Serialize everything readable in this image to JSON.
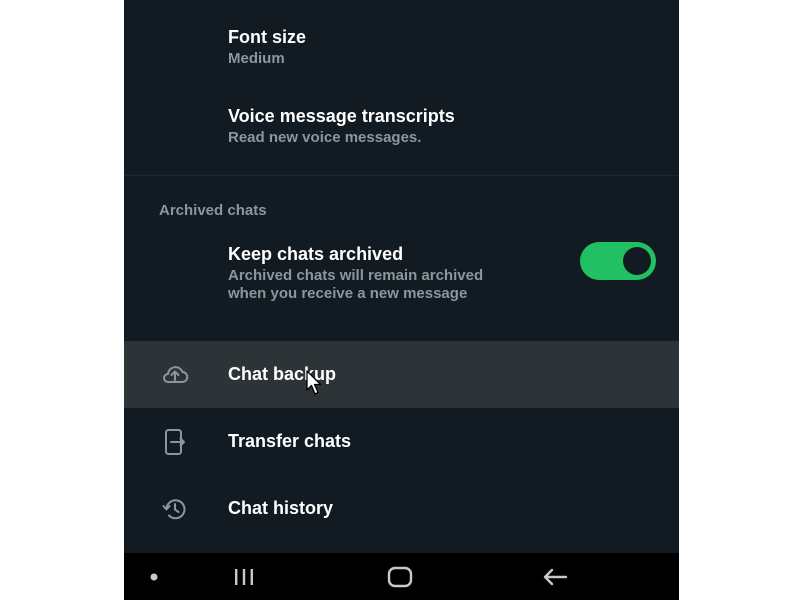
{
  "settings": {
    "font_size": {
      "title": "Font size",
      "value": "Medium"
    },
    "voice_transcripts": {
      "title": "Voice message transcripts",
      "subtitle": "Read new voice messages."
    },
    "archived_section": {
      "header": "Archived chats",
      "keep_archived": {
        "title": "Keep chats archived",
        "subtitle_line1": "Archived chats will remain archived",
        "subtitle_line2": "when you receive a new message",
        "enabled": true
      }
    },
    "menu": [
      {
        "label": "Chat backup",
        "icon": "cloud-upload-icon",
        "highlighted": true
      },
      {
        "label": "Transfer chats",
        "icon": "phone-transfer-icon",
        "highlighted": false
      },
      {
        "label": "Chat history",
        "icon": "history-icon",
        "highlighted": false
      }
    ]
  },
  "colors": {
    "background": "#111b21",
    "accent_green": "#21c063",
    "primary_text": "#ffffff",
    "secondary_text": "#8b979d",
    "highlight_row": "#2c3438",
    "navbar": "#000000"
  },
  "navbar": {
    "buttons": [
      "dot-icon",
      "recents-icon",
      "home-icon",
      "back-icon"
    ]
  }
}
